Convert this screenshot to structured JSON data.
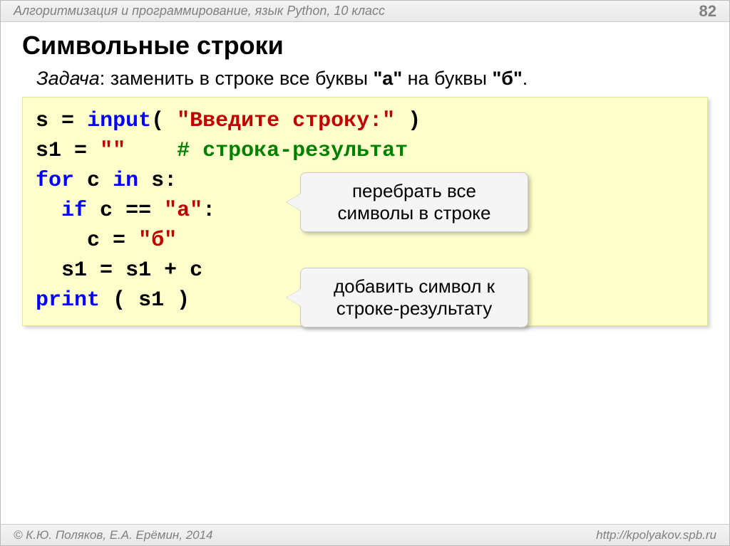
{
  "header": {
    "title": "Алгоритмизация и программирование, язык Python, 10 класс",
    "page": "82"
  },
  "title": "Символьные строки",
  "task": {
    "label": "Задача",
    "text": ": заменить в строке все буквы ",
    "lit1": "\"а\"",
    "mid": " на буквы ",
    "lit2": "\"б\"",
    "end": "."
  },
  "code": {
    "w": {
      "s": "s",
      "eq": "=",
      "s1": "s1",
      "empty": "\"\"",
      "for": "for",
      "c": "c",
      "in": "in",
      "colon": ":",
      "if": "if",
      "eqeq": "==",
      "plus": "+",
      "lpar": "(",
      "rpar": ")",
      "sp": " "
    },
    "input_fn": "input",
    "input_prompt": "\"Введите строку:\"",
    "comment": "# строка-результат",
    "lit_a": "\"а\"",
    "lit_b": "\"б\"",
    "print_fn": "print"
  },
  "callout1": "перебрать все символы в строке",
  "callout2": "добавить символ к строке-результату",
  "footer": {
    "left": "© К.Ю. Поляков, Е.А. Ерёмин, 2014",
    "right": "http://kpolyakov.spb.ru"
  }
}
